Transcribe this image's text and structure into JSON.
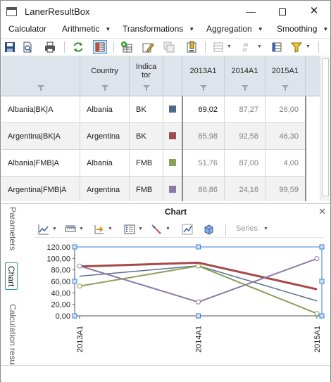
{
  "window": {
    "title": "LanerResultBox"
  },
  "menu": [
    {
      "label": "Calculator",
      "caret": false
    },
    {
      "label": "Arithmetic",
      "caret": true
    },
    {
      "label": "Transformations",
      "caret": true
    },
    {
      "label": "Aggregation",
      "caret": true
    },
    {
      "label": "Smoothing",
      "caret": true
    }
  ],
  "toolbar": {
    "icons": [
      "save-icon",
      "print-preview-icon",
      "print-icon",
      "refresh-icon",
      "table-view-icon",
      "add-series-icon",
      "edit-icon",
      "copy-icon",
      "calculate-icon",
      "hide-rows-icon",
      "decimal-places-icon",
      "columns-icon",
      "filter-icon"
    ]
  },
  "grid": {
    "headers": {
      "country": "Country",
      "indicator": "Indica tor",
      "col1": "2013A1",
      "col2": "2014A1",
      "col3": "2015A1"
    },
    "rows": [
      {
        "name": "Albania|BK|A",
        "country": "Albania",
        "indicator": "BK",
        "color": "#4f6a8c",
        "v1": "69,02",
        "v2": "87,27",
        "v3": "26,00"
      },
      {
        "name": "Argentina|BK|A",
        "country": "Argentina",
        "indicator": "BK",
        "color": "#a04a4a",
        "v1": "85,98",
        "v2": "92,58",
        "v3": "46,30"
      },
      {
        "name": "Albania|FMB|A",
        "country": "Albania",
        "indicator": "FMB",
        "color": "#8aa05a",
        "v1": "51,76",
        "v2": "87,00",
        "v3": "4,00"
      },
      {
        "name": "Argentina|FMB|A",
        "country": "Argentina",
        "indicator": "FMB",
        "color": "#8a7aa8",
        "v1": "86,86",
        "v2": "24,16",
        "v3": "99,59"
      }
    ]
  },
  "chart_panel": {
    "title": "Chart",
    "side_tabs": [
      "Parameters",
      "Chart",
      "Calculation results"
    ],
    "series_dropdown": "Series",
    "icons": [
      "chart-type-icon",
      "axis-scale-icon",
      "series-order-icon",
      "legend-icon",
      "data-labels-icon",
      "trend-icon",
      "3d-icon"
    ]
  },
  "chart_data": {
    "type": "line",
    "categories": [
      "2013A1",
      "2014A1",
      "2015A1"
    ],
    "ylim": [
      0,
      120
    ],
    "yticks": [
      "0,00",
      "20,00",
      "40,00",
      "60,00",
      "80,00",
      "100,00",
      "120,00"
    ],
    "grid": false,
    "series": [
      {
        "values": [
          69.02,
          87.27,
          26.0
        ],
        "color": "#5a7090",
        "width": 1.5
      },
      {
        "values": [
          85.98,
          92.58,
          46.3
        ],
        "color": "#a84848",
        "width": 3
      },
      {
        "values": [
          51.76,
          87.0,
          4.0
        ],
        "color": "#8aa05a",
        "width": 2
      },
      {
        "values": [
          86.86,
          24.16,
          99.59
        ],
        "color": "#8a7aa8",
        "width": 2
      }
    ]
  }
}
